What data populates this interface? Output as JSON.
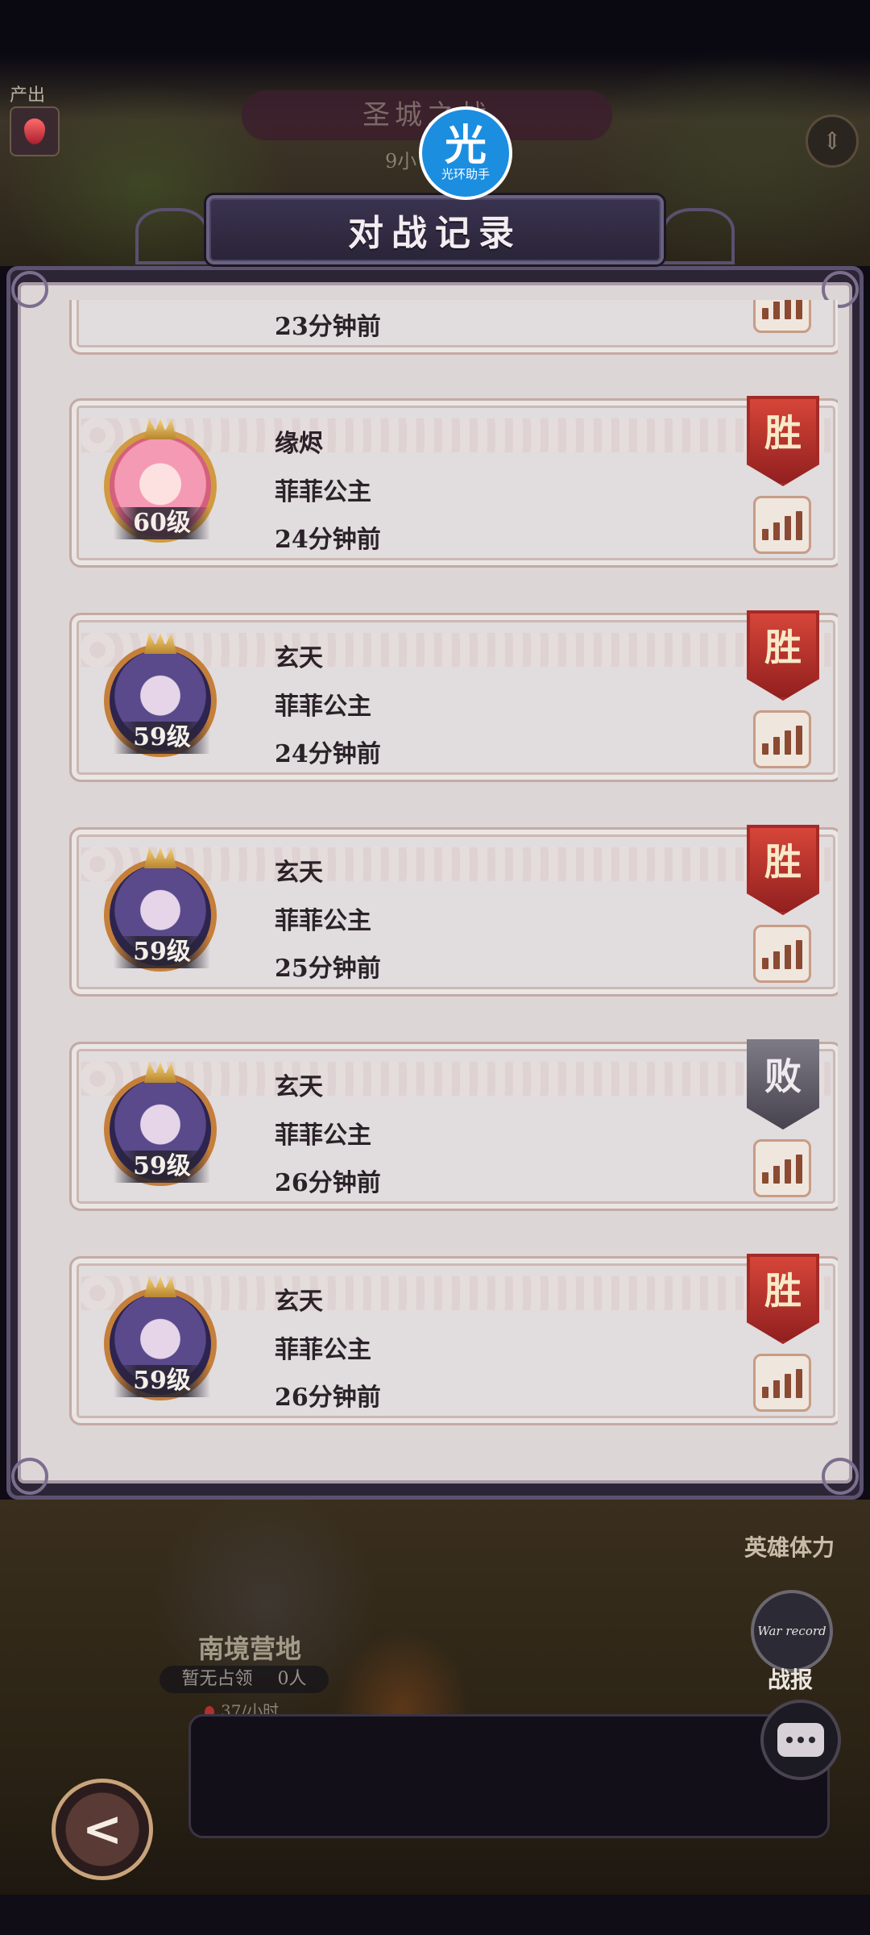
{
  "background": {
    "production_label": "产出",
    "top_banner_title": "圣城之战",
    "top_banner_sub": "9小",
    "hero_stamina_label": "英雄体力",
    "camp": {
      "name": "南境营地",
      "status": "暂无占领",
      "count": "0人",
      "rate": "37/小时"
    },
    "war_badge_text": "War record",
    "war_label": "战报"
  },
  "watermark": {
    "glyph": "光",
    "text": "光环助手"
  },
  "dialog": {
    "title": "对战记录",
    "partial_top_time": "23分钟前",
    "records": [
      {
        "nickname": "缘烬",
        "server": "菲菲公主",
        "time": "24分钟前",
        "level": "60级",
        "result": "胜",
        "outcome": "win",
        "avatar": "pink"
      },
      {
        "nickname": "玄天",
        "server": "菲菲公主",
        "time": "24分钟前",
        "level": "59级",
        "result": "胜",
        "outcome": "win",
        "avatar": "purple"
      },
      {
        "nickname": "玄天",
        "server": "菲菲公主",
        "time": "25分钟前",
        "level": "59级",
        "result": "胜",
        "outcome": "win",
        "avatar": "purple"
      },
      {
        "nickname": "玄天",
        "server": "菲菲公主",
        "time": "26分钟前",
        "level": "59级",
        "result": "败",
        "outcome": "lose",
        "avatar": "purple"
      },
      {
        "nickname": "玄天",
        "server": "菲菲公主",
        "time": "26分钟前",
        "level": "59级",
        "result": "胜",
        "outcome": "win",
        "avatar": "purple"
      }
    ]
  },
  "icons": {
    "back": "back-arrow-icon",
    "stats": "bar-chart-icon",
    "chat": "chat-bubble-icon",
    "scroll": "scroll-arrows-icon"
  },
  "colors": {
    "win": "#b8302a",
    "lose": "#5e5a66",
    "panel": "#ddd6d6"
  }
}
